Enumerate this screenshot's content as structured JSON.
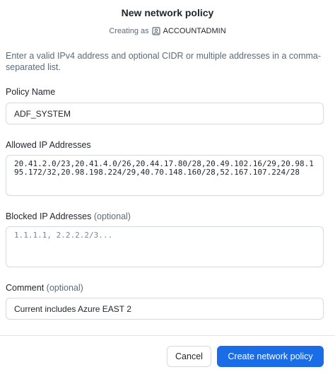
{
  "dialog": {
    "title": "New network policy",
    "creating_as_label": "Creating as",
    "role_name": "ACCOUNTADMIN",
    "role_icon": "user-badge-icon",
    "intro": "Enter a valid IPv4 address and optional CIDR or multiple addresses in a comma-separated list."
  },
  "policy_name": {
    "label": "Policy Name",
    "value": "ADF_SYSTEM"
  },
  "allowed_ips": {
    "label": "Allowed IP Addresses",
    "value": "20.41.2.0/23,20.41.4.0/26,20.44.17.80/28,20.49.102.16/29,20.98.195.172/32,20.98.198.224/29,40.70.148.160/28,52.167.107.224/28"
  },
  "blocked_ips": {
    "label": "Blocked IP Addresses",
    "optional": "(optional)",
    "placeholder": "1.1.1.1, 2.2.2.2/3..."
  },
  "comment": {
    "label": "Comment",
    "optional": "(optional)",
    "value": "Current includes Azure EAST 2"
  },
  "footer": {
    "cancel_label": "Cancel",
    "create_label": "Create network policy"
  },
  "colors": {
    "primary": "#1a6ce7",
    "border": "#d5dae1",
    "muted_text": "#5d6a79"
  }
}
